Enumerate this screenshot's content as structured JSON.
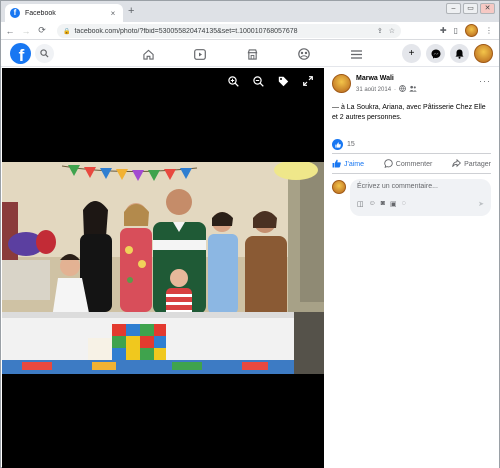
{
  "browser": {
    "tab_title": "Facebook",
    "tab_favicon": "f",
    "tab_close": "×",
    "new_tab": "+",
    "url": "facebook.com/photo/?fbid=530055820474135&set=t.100010768057678",
    "window_controls": [
      "–",
      "▭",
      "✕"
    ]
  },
  "fbnav": {
    "logo": "f",
    "tabs": [
      "home-icon",
      "watch-icon",
      "marketplace-icon",
      "groups-icon",
      "menu-icon"
    ]
  },
  "viewer": {
    "controls": [
      "zoom-in-icon",
      "zoom-out-icon",
      "tag-icon",
      "fullscreen-icon"
    ]
  },
  "post": {
    "author": "Marwa Wali",
    "date": "31 août 2014",
    "more": "···",
    "caption": "— à La Soukra, Ariana, avec Pâtisserie Chez Elle et 2 autres personnes.",
    "reaction_count": "15",
    "actions": {
      "like": "J'aime",
      "comment": "Commenter",
      "share": "Partager"
    },
    "comment_placeholder": "Écrivez un commentaire..."
  },
  "colors": {
    "facebook_blue": "#1877f2",
    "viewer_bg": "#000000"
  }
}
